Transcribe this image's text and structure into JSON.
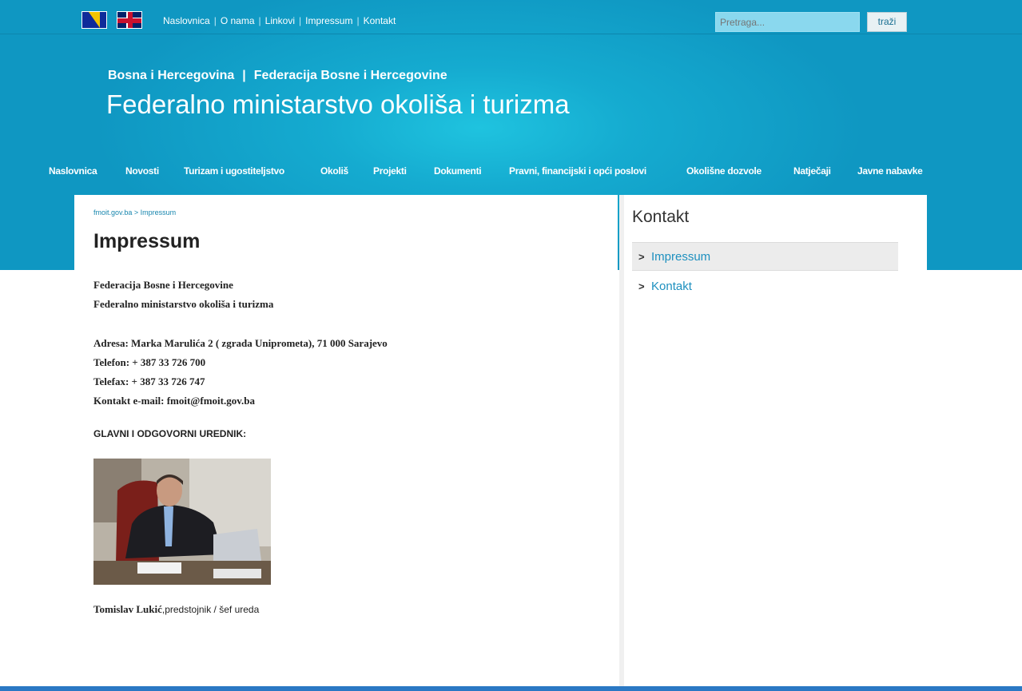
{
  "top_links": [
    "Naslovnica",
    "O nama",
    "Linkovi",
    "Impressum",
    "Kontakt"
  ],
  "search": {
    "placeholder": "Pretraga...",
    "button": "traži"
  },
  "header": {
    "country": "Bosna i Hercegovina",
    "separator": "|",
    "federation": "Federacija Bosne i Hercegovine",
    "ministry": "Federalno ministarstvo okoliša i turizma"
  },
  "nav": [
    "Naslovnica",
    "Novosti",
    "Turizam i ugostiteljstvo",
    "Okoliš",
    "Projekti",
    "Dokumenti",
    "Pravni, financijski i opći poslovi",
    "Okolišne dozvole",
    "Natječaji",
    "Javne nabavke"
  ],
  "breadcrumb": "fmoit.gov.ba > Impressum",
  "page_title": "Impressum",
  "content": {
    "line1": "Federacija Bosne i Hercegovine",
    "line2": "Federalno ministarstvo okoliša i turizma",
    "address": "Adresa: Marka Marulića 2 ( zgrada Uniprometa), 71 000 Sarajevo",
    "phone": "Telefon: + 387 33 726 700",
    "fax": "Telefax: + 387 33 726 747",
    "email": "Kontakt e-mail: fmoit@fmoit.gov.ba",
    "editor_heading": "GLAVNI I ODGOVORNI UREDNIK:",
    "caption_name": "Tomislav Lukić",
    "caption_role": ",predstojnik / šef ureda"
  },
  "sidebar": {
    "title": "Kontakt",
    "items": [
      {
        "label": "Impressum"
      },
      {
        "label": "Kontakt"
      }
    ]
  },
  "colors": {
    "header": "#15abd0",
    "link": "#1e90bf",
    "accent_line": "#2a78c4"
  }
}
